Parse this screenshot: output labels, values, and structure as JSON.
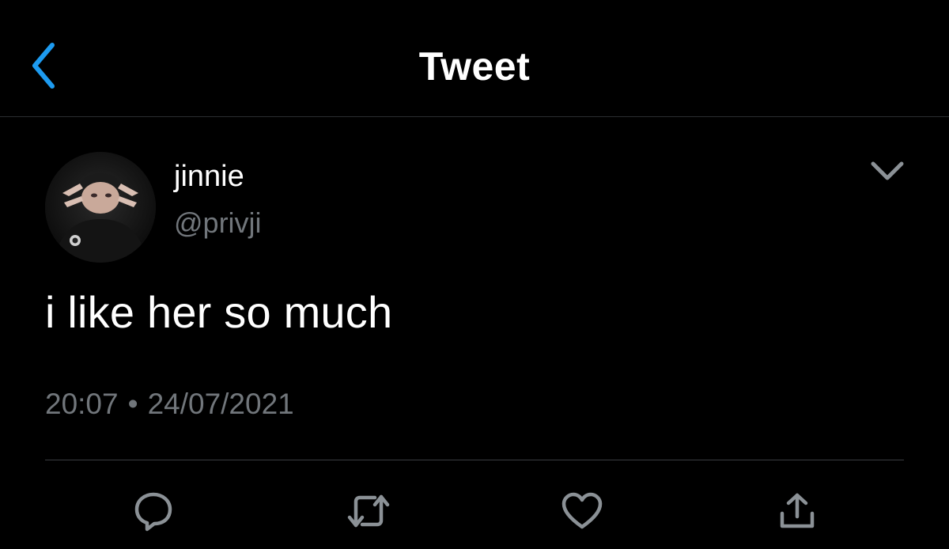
{
  "header": {
    "title": "Tweet",
    "back_icon": "chevron-left-icon",
    "accent_color": "#1d9bf0"
  },
  "author": {
    "display_name": "jinnie",
    "handle": "@privji",
    "avatar_icon": "avatar"
  },
  "tweet": {
    "text": "i like her so much",
    "time": "20:07",
    "separator": "•",
    "date": "24/07/2021"
  },
  "actions": [
    {
      "name": "reply",
      "icon": "reply-icon"
    },
    {
      "name": "retweet",
      "icon": "retweet-icon"
    },
    {
      "name": "like",
      "icon": "heart-icon"
    },
    {
      "name": "share",
      "icon": "share-icon"
    }
  ],
  "colors": {
    "background": "#000000",
    "text_primary": "#ffffff",
    "text_secondary": "#71767b",
    "icon_gray": "#8b9196",
    "divider": "#3a3d41"
  }
}
